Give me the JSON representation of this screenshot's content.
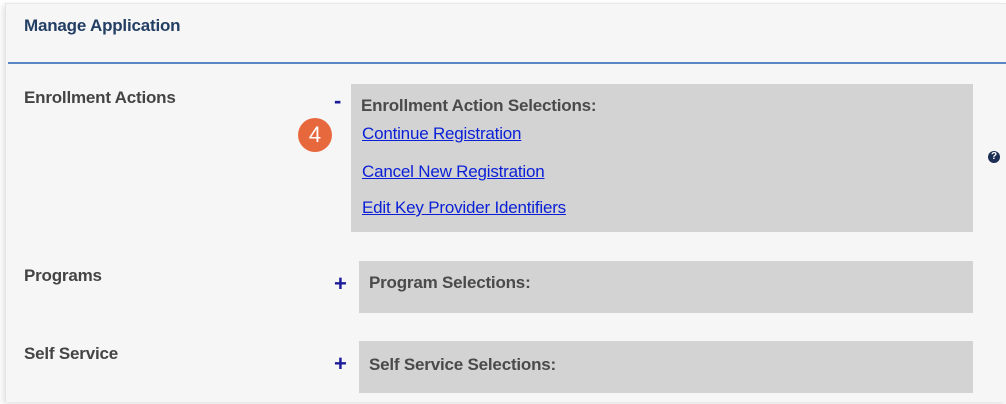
{
  "header": {
    "title": "Manage Application"
  },
  "enrollment": {
    "label": "Enrollment Actions",
    "toggle": "-",
    "panel_title": "Enrollment Action Selections:",
    "links": [
      "Continue Registration",
      "Cancel New Registration",
      "Edit Key Provider Identifiers"
    ],
    "step_badge": "4",
    "help": "?"
  },
  "programs": {
    "label": "Programs",
    "toggle": "+",
    "panel_title": "Program Selections:"
  },
  "self_service": {
    "label": "Self Service",
    "toggle": "+",
    "panel_title": "Self Service Selections:"
  },
  "colors": {
    "header_text": "#233e63",
    "rule": "#5b86c4",
    "panel_bg": "#d3d3d3",
    "link": "#0a1fd6",
    "toggle": "#1a1a9a",
    "badge": "#e8683d"
  }
}
